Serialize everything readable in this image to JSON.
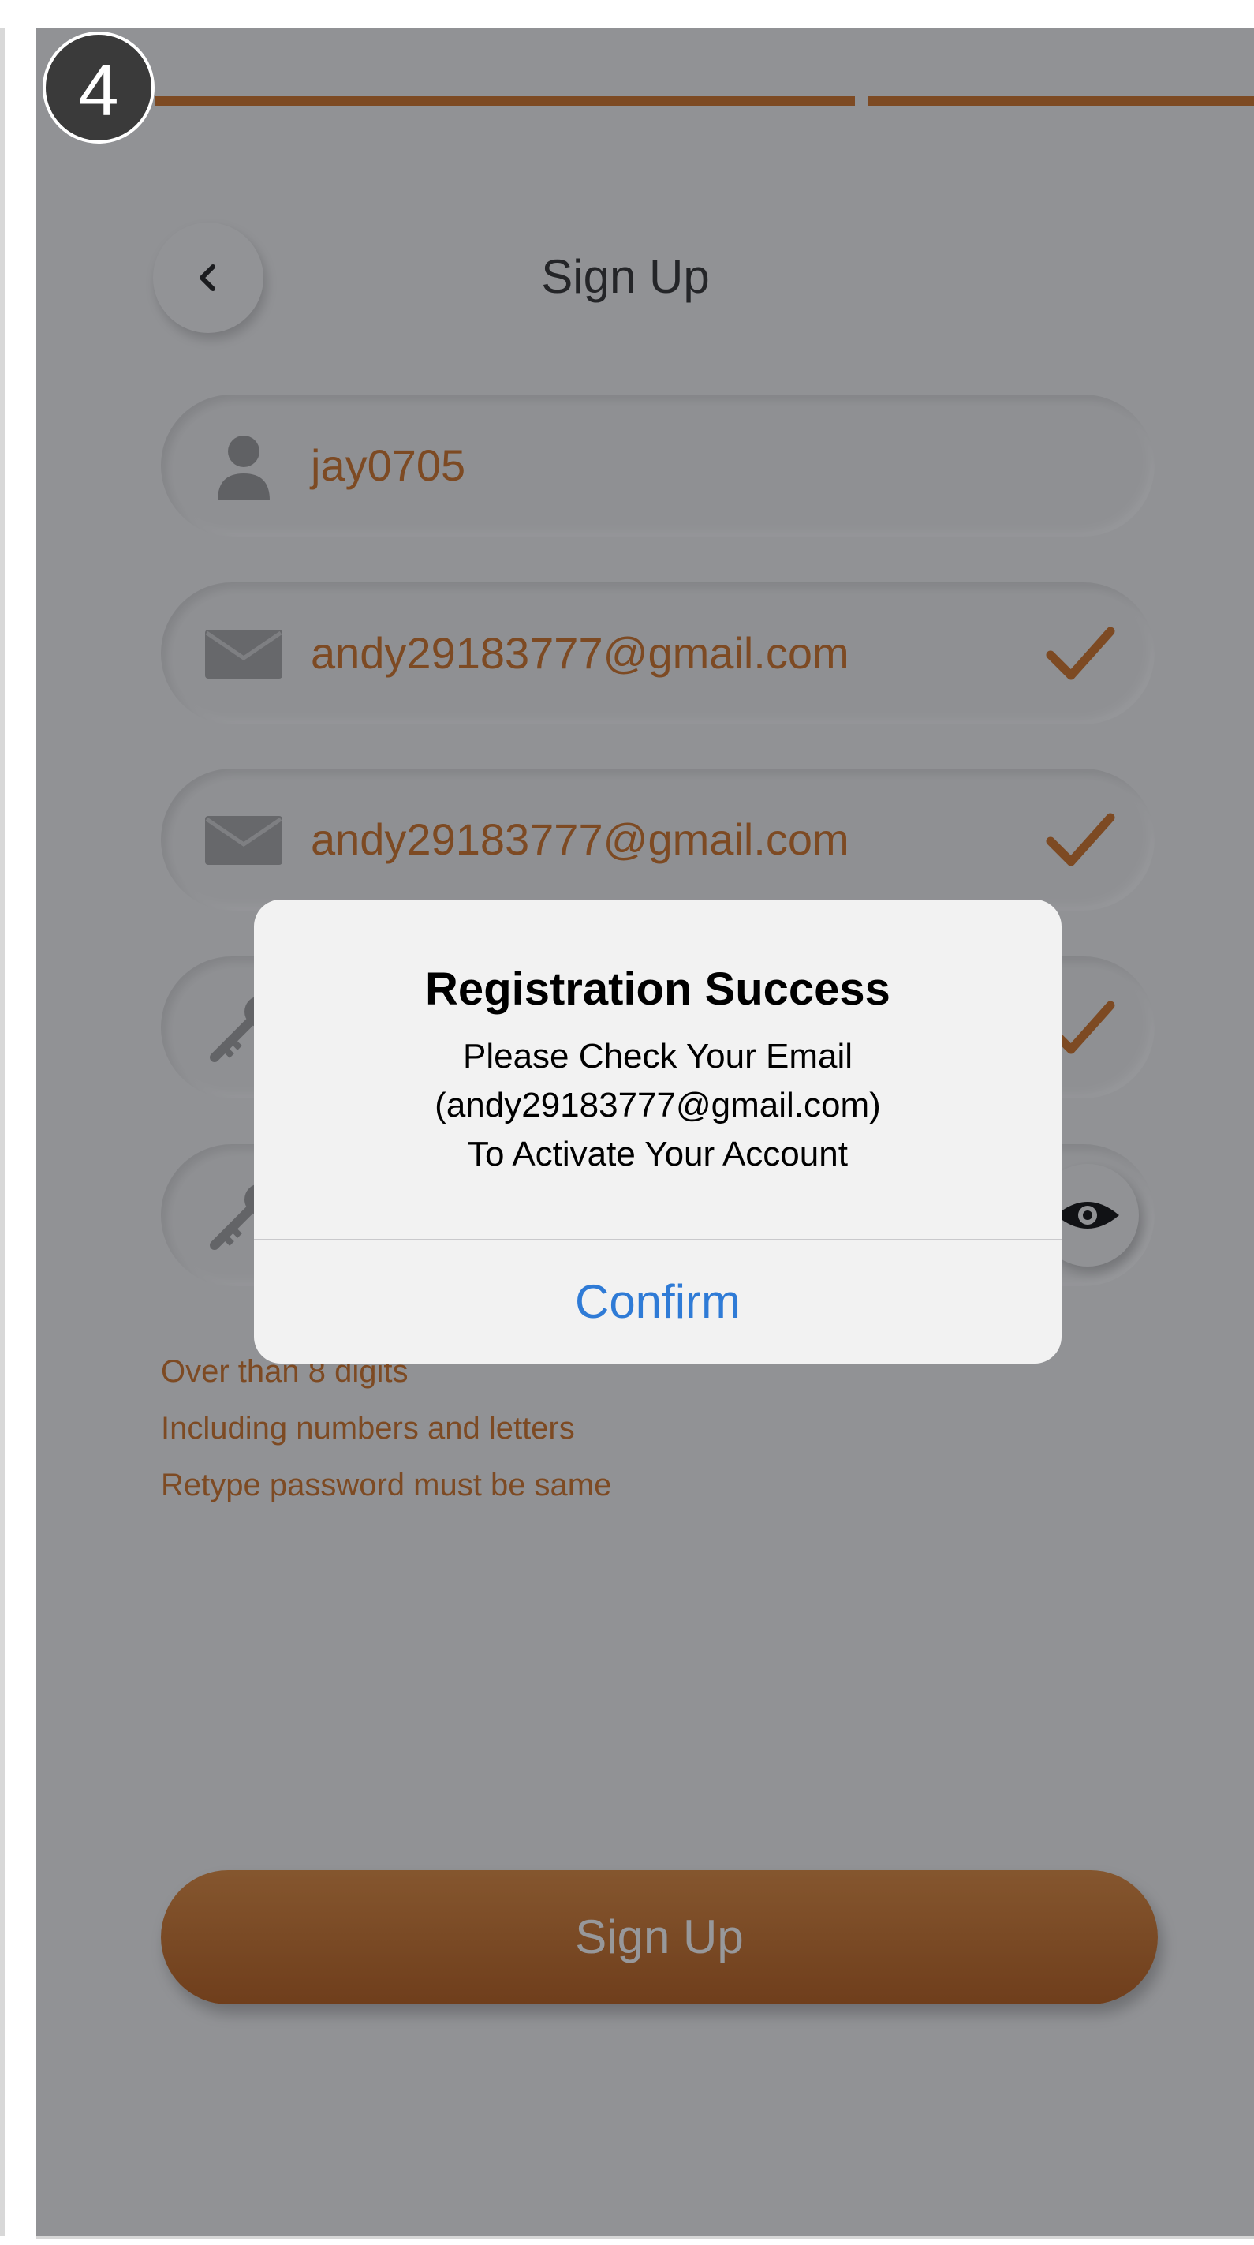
{
  "step_number": "4",
  "header": {
    "title": "Sign Up"
  },
  "form": {
    "username": "jay0705",
    "email": "andy29183777@gmail.com",
    "email_confirm": "andy29183777@gmail.com"
  },
  "hints": [
    "Over than 8 digits",
    "Including numbers and letters",
    "Retype password must be same"
  ],
  "signup_label": "Sign Up",
  "dialog": {
    "title": "Registration Success",
    "message_line1": "Please Check Your Email",
    "message_line2": "(andy29183777@gmail.com)",
    "message_line3": "To Activate Your Account",
    "confirm_label": "Confirm"
  },
  "colors": {
    "accent": "#d0752a",
    "link": "#2f7bd6",
    "badge": "#3a3a3a"
  },
  "icons": [
    "back-arrow-icon",
    "user-icon",
    "email-icon",
    "key-icon",
    "check-icon",
    "eye-icon"
  ]
}
